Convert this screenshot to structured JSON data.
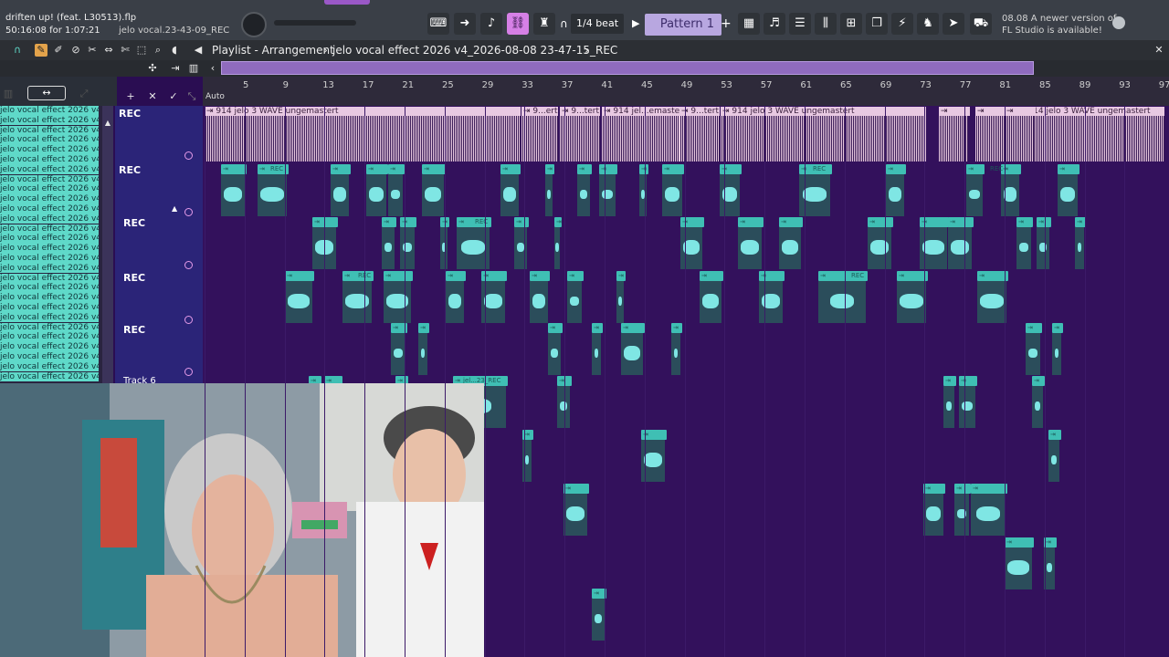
{
  "toolbar": {
    "file_title": "driften up! (feat. L30513).flp",
    "elapsed": "50:16:08 for 1:07:21",
    "hint": "jelo vocal.23-43-09_REC",
    "snap": "1/4 beat",
    "pattern": "Pattern 1",
    "news_line1": "08.08  A newer version of",
    "news_line2": "FL Studio is available!"
  },
  "playlist": {
    "header": "Playlist - Arrangement",
    "crumb": "jelo vocal effect 2026 v4_2026-08-08 23-47-15_REC",
    "auto_label": "Auto"
  },
  "ruler": {
    "numbers": [
      "5",
      "9",
      "13",
      "17",
      "21",
      "25",
      "29",
      "33",
      "37",
      "41",
      "45",
      "49",
      "53",
      "57",
      "61",
      "65",
      "69",
      "73",
      "77",
      "81",
      "85",
      "89",
      "93",
      "97"
    ]
  },
  "picker_items": [
    "jelo vocal effect 2026 v4_2",
    "jelo vocal effect 2026 v4_2",
    "jelo vocal effect 2026 v4_2",
    "jelo vocal effect 2026 v4_2",
    "jelo vocal effect 2026 v4_2",
    "jelo vocal effect 2026 v4_2",
    "jelo vocal effect 2026 v4_2",
    "jelo vocal effect 2026 v4_2",
    "jelo vocal effect 2026 v4_2",
    "jelo vocal effect 2026 v4_2",
    "jelo vocal effect 2026 v4_2",
    "jelo vocal effect 2026 v4_2",
    "jelo vocal effect 2026 v4_2",
    "jelo vocal effect 2026 v4_2",
    "jelo vocal effect 2026 v4_2",
    "jelo vocal effect 2026 v4_2",
    "jelo vocal effect 2026 v4_2",
    "jelo vocal effect 2026 v4_2",
    "jelo vocal effect 2026 v4_2",
    "jelo vocal effect 2026 v4_2",
    "jelo vocal effect 2026 v4_2",
    "jelo vocal effect 2026 v4_2",
    "jelo vocal effect 2026 v4_2",
    "jelo vocal effect 2026 v4_2",
    "jelo vocal effect 2026 v4_2",
    "jelo vocal effect 2026 v4_2",
    "jelo vocal effect 2026 v4_2",
    "jelo vocal effect 2026 v4_2"
  ],
  "tracks": [
    {
      "label": "REC"
    },
    {
      "label": "REC"
    },
    {
      "label": "REC"
    },
    {
      "label": "REC"
    },
    {
      "label": "REC"
    },
    {
      "label": "Track 6"
    }
  ],
  "big_clips": [
    {
      "label": "914 jelo 3 WAVE ungemastert"
    },
    {
      "label": "9...ert"
    },
    {
      "label": "9...tert"
    },
    {
      "label": "914 jel...emastert"
    },
    {
      "label": "9...tert"
    },
    {
      "label": "914 jelo 3 WAVE ungemastert"
    },
    {
      "label": "914 jelo 3 WAVE ungemastert"
    }
  ],
  "small_clip_label": "REC",
  "track6_clip_label": "jel...23_REC",
  "colors": {
    "grid_bg": "#33115c",
    "clip_head": "#3fbfb4",
    "wave": "#7fe6e4",
    "big_clip": "#e8c9e2",
    "pattern": "#b8a7e0",
    "toolbar": "#3a3f47"
  }
}
